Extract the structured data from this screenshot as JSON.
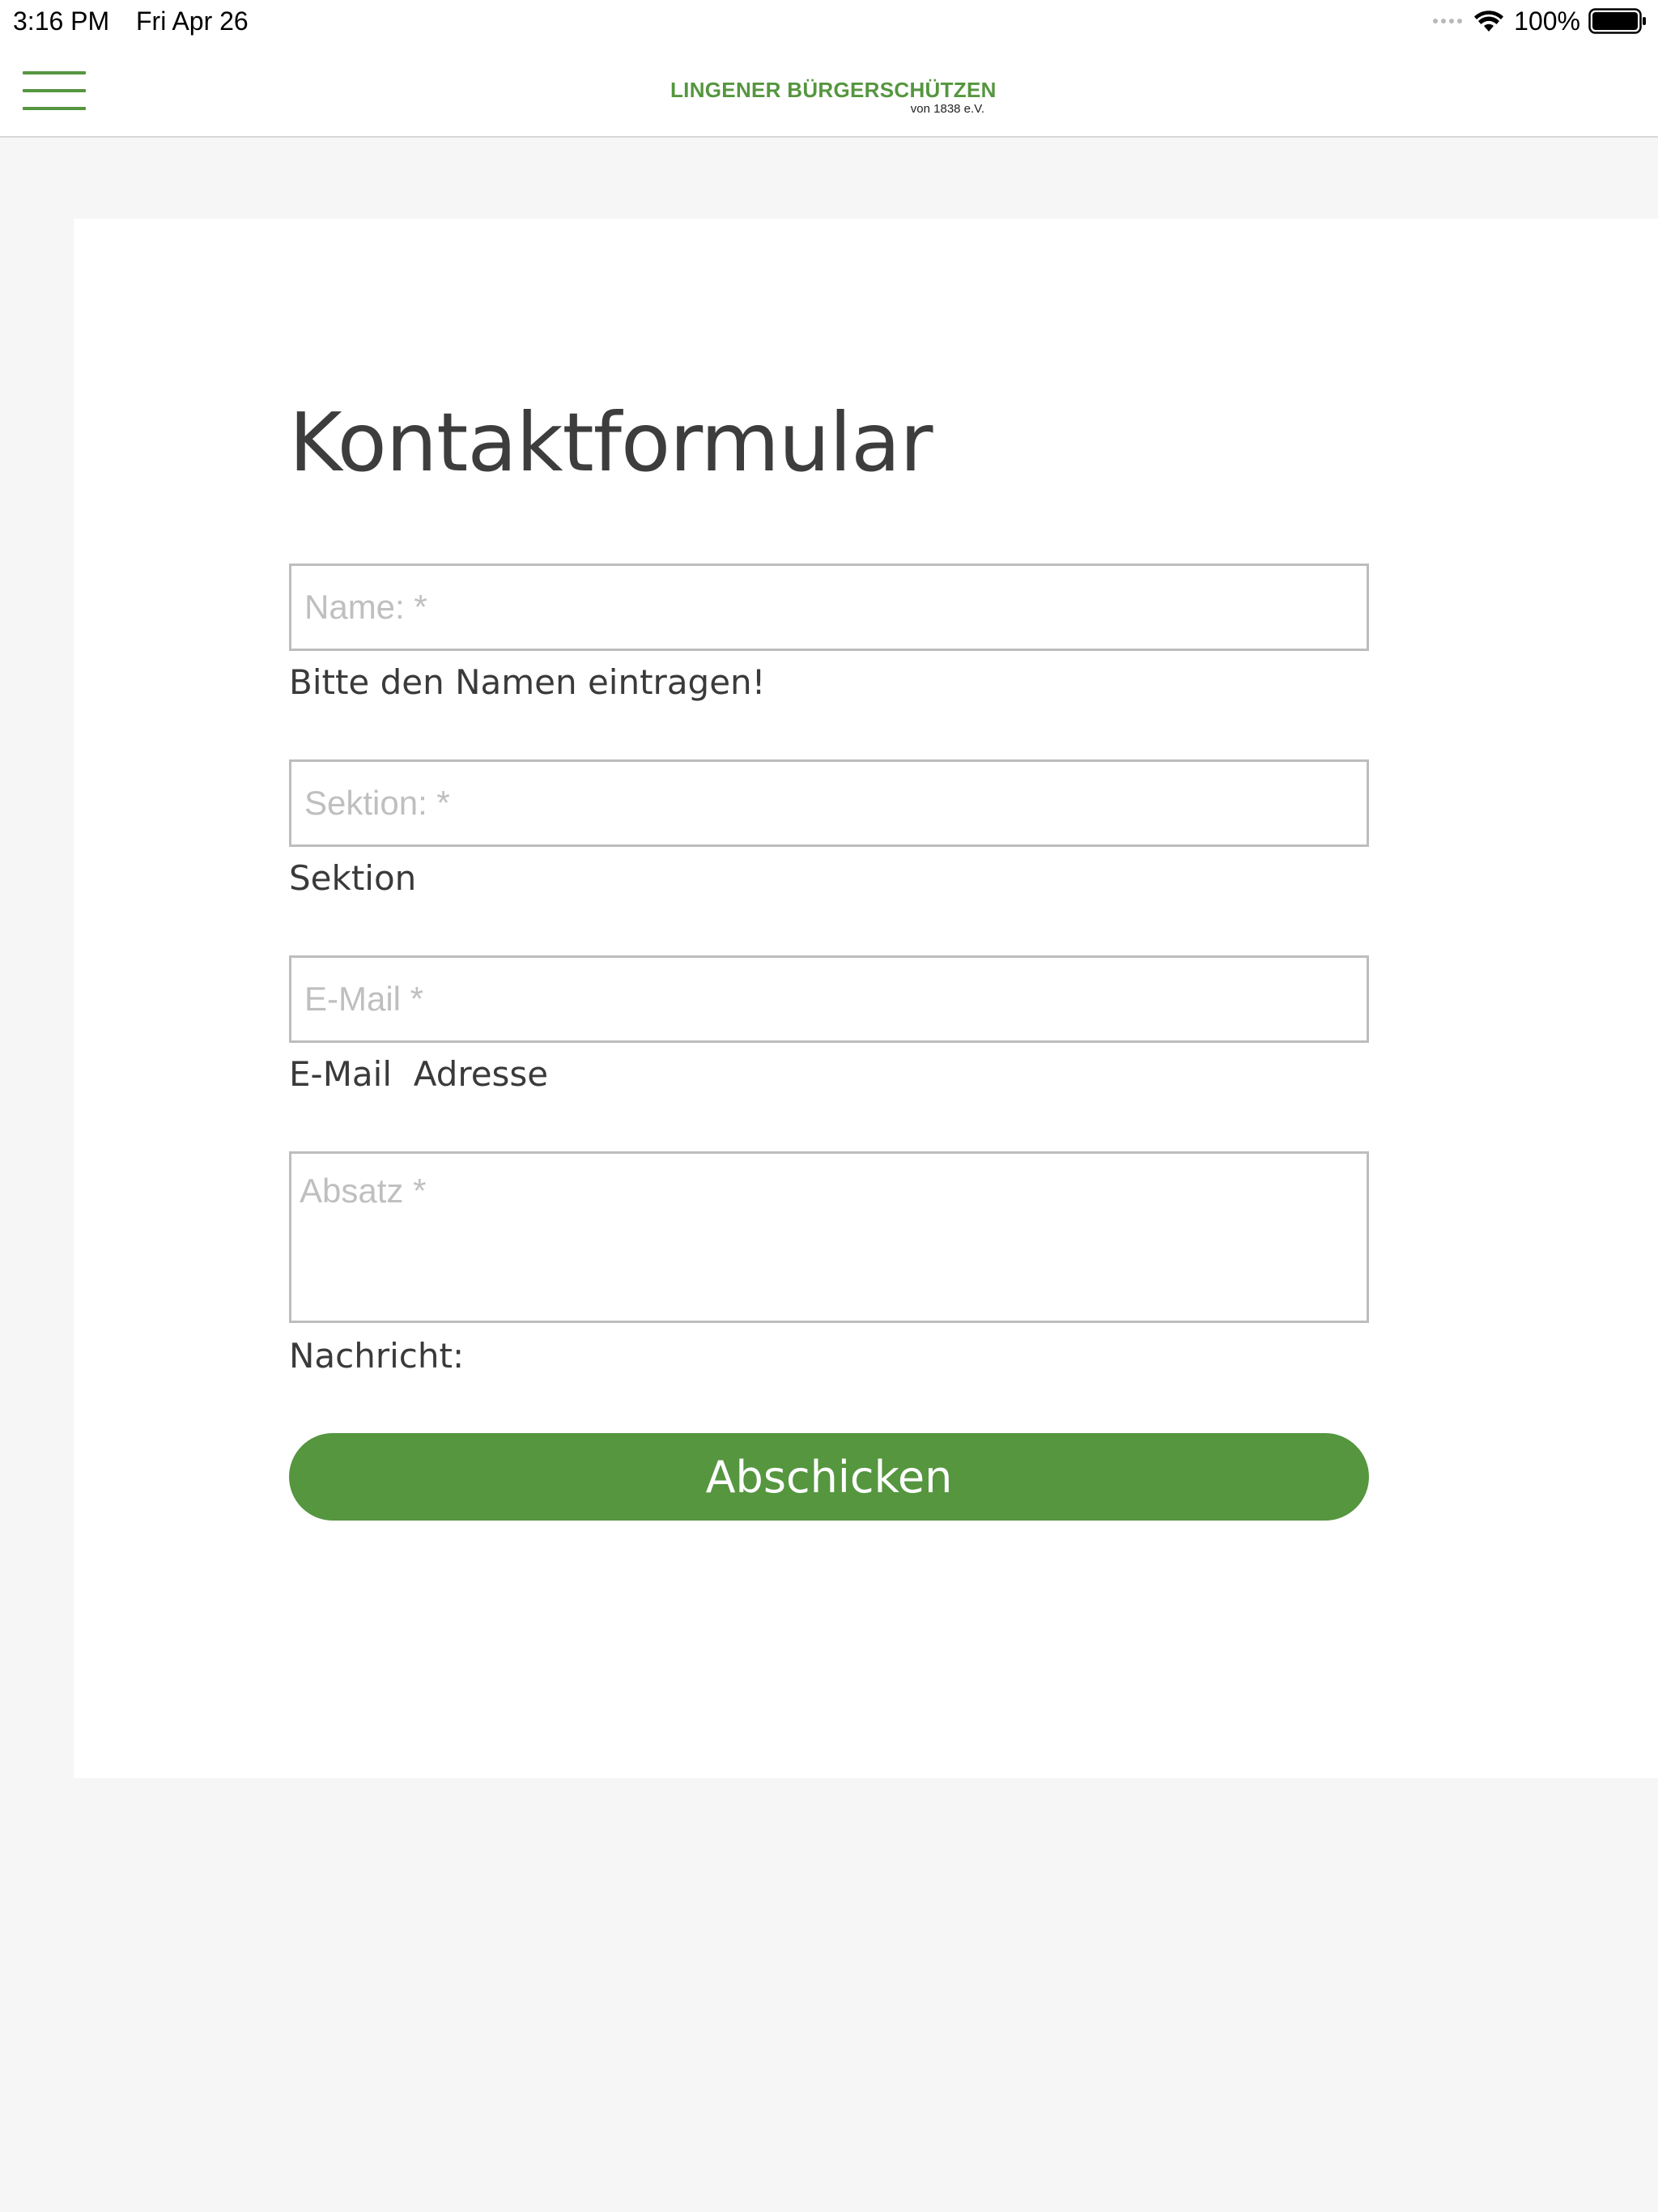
{
  "status_bar": {
    "time": "3:16 PM",
    "date": "Fri Apr 26",
    "battery_percent": "100%",
    "icons": [
      "cellular-signal-icon",
      "wifi-icon",
      "battery-icon"
    ]
  },
  "header": {
    "menu_icon": "hamburger-menu-icon",
    "brand_name": "LINGENER BÜRGERSCHÜTZEN",
    "brand_sub": "von 1838 e.V."
  },
  "form": {
    "title": "Kontaktformular",
    "fields": [
      {
        "placeholder": "Name: *",
        "value": "",
        "label": "Bitte den Namen eintragen!"
      },
      {
        "placeholder": "Sektion: *",
        "value": "",
        "label": "Sektion"
      },
      {
        "placeholder": "E-Mail *",
        "value": "",
        "label": "E-Mail  Adresse"
      },
      {
        "placeholder": "Absatz *",
        "value": "",
        "label": "Nachricht:"
      }
    ],
    "submit_label": "Abschicken"
  },
  "colors": {
    "brand_green": "#55963f",
    "page_background": "#f6f6f6",
    "card_background": "#ffffff",
    "field_border": "#bdbdbd",
    "placeholder_text": "#bfbfbf",
    "text": "#3a3a3a"
  }
}
